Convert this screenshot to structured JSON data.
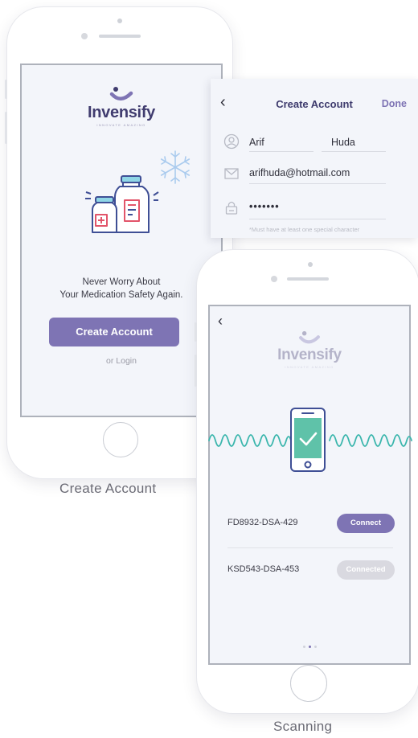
{
  "create_account_screen": {
    "brand": "Invensify",
    "tagline": "INNOVATE AMAZING",
    "headline_line1": "Never Worry About",
    "headline_line2": "Your Medication Safety Again.",
    "primary_button": "Create Account",
    "login_link": "or Login",
    "caption": "Create Account"
  },
  "create_account_form": {
    "title": "Create Account",
    "done_label": "Done",
    "first_name": "Arif",
    "last_name": "Huda",
    "email": "arifhuda@hotmail.com",
    "password": "•••••••",
    "password_hint": "*Must have at least one special character"
  },
  "scanning_screen": {
    "brand": "Invensify",
    "tagline": "INNOVATE AMAZING",
    "devices": [
      {
        "id": "FD8932-DSA-429",
        "action": "Connect",
        "state": "available",
        "color": "#7e74b4"
      },
      {
        "id": "KSD543-DSA-453",
        "action": "Connected",
        "state": "connected",
        "color": "#d9d9e0"
      }
    ],
    "pager": {
      "total": 3,
      "active": 2
    },
    "caption": "Scanning"
  },
  "colors": {
    "brand_primary": "#7e74b4",
    "brand_dark": "#403c6f",
    "wave": "#3bb6ad",
    "check_green": "#5fc2a9",
    "icon_blue": "#3f4f95",
    "accent_red": "#e2556a",
    "snowflake": "#aacbee"
  }
}
